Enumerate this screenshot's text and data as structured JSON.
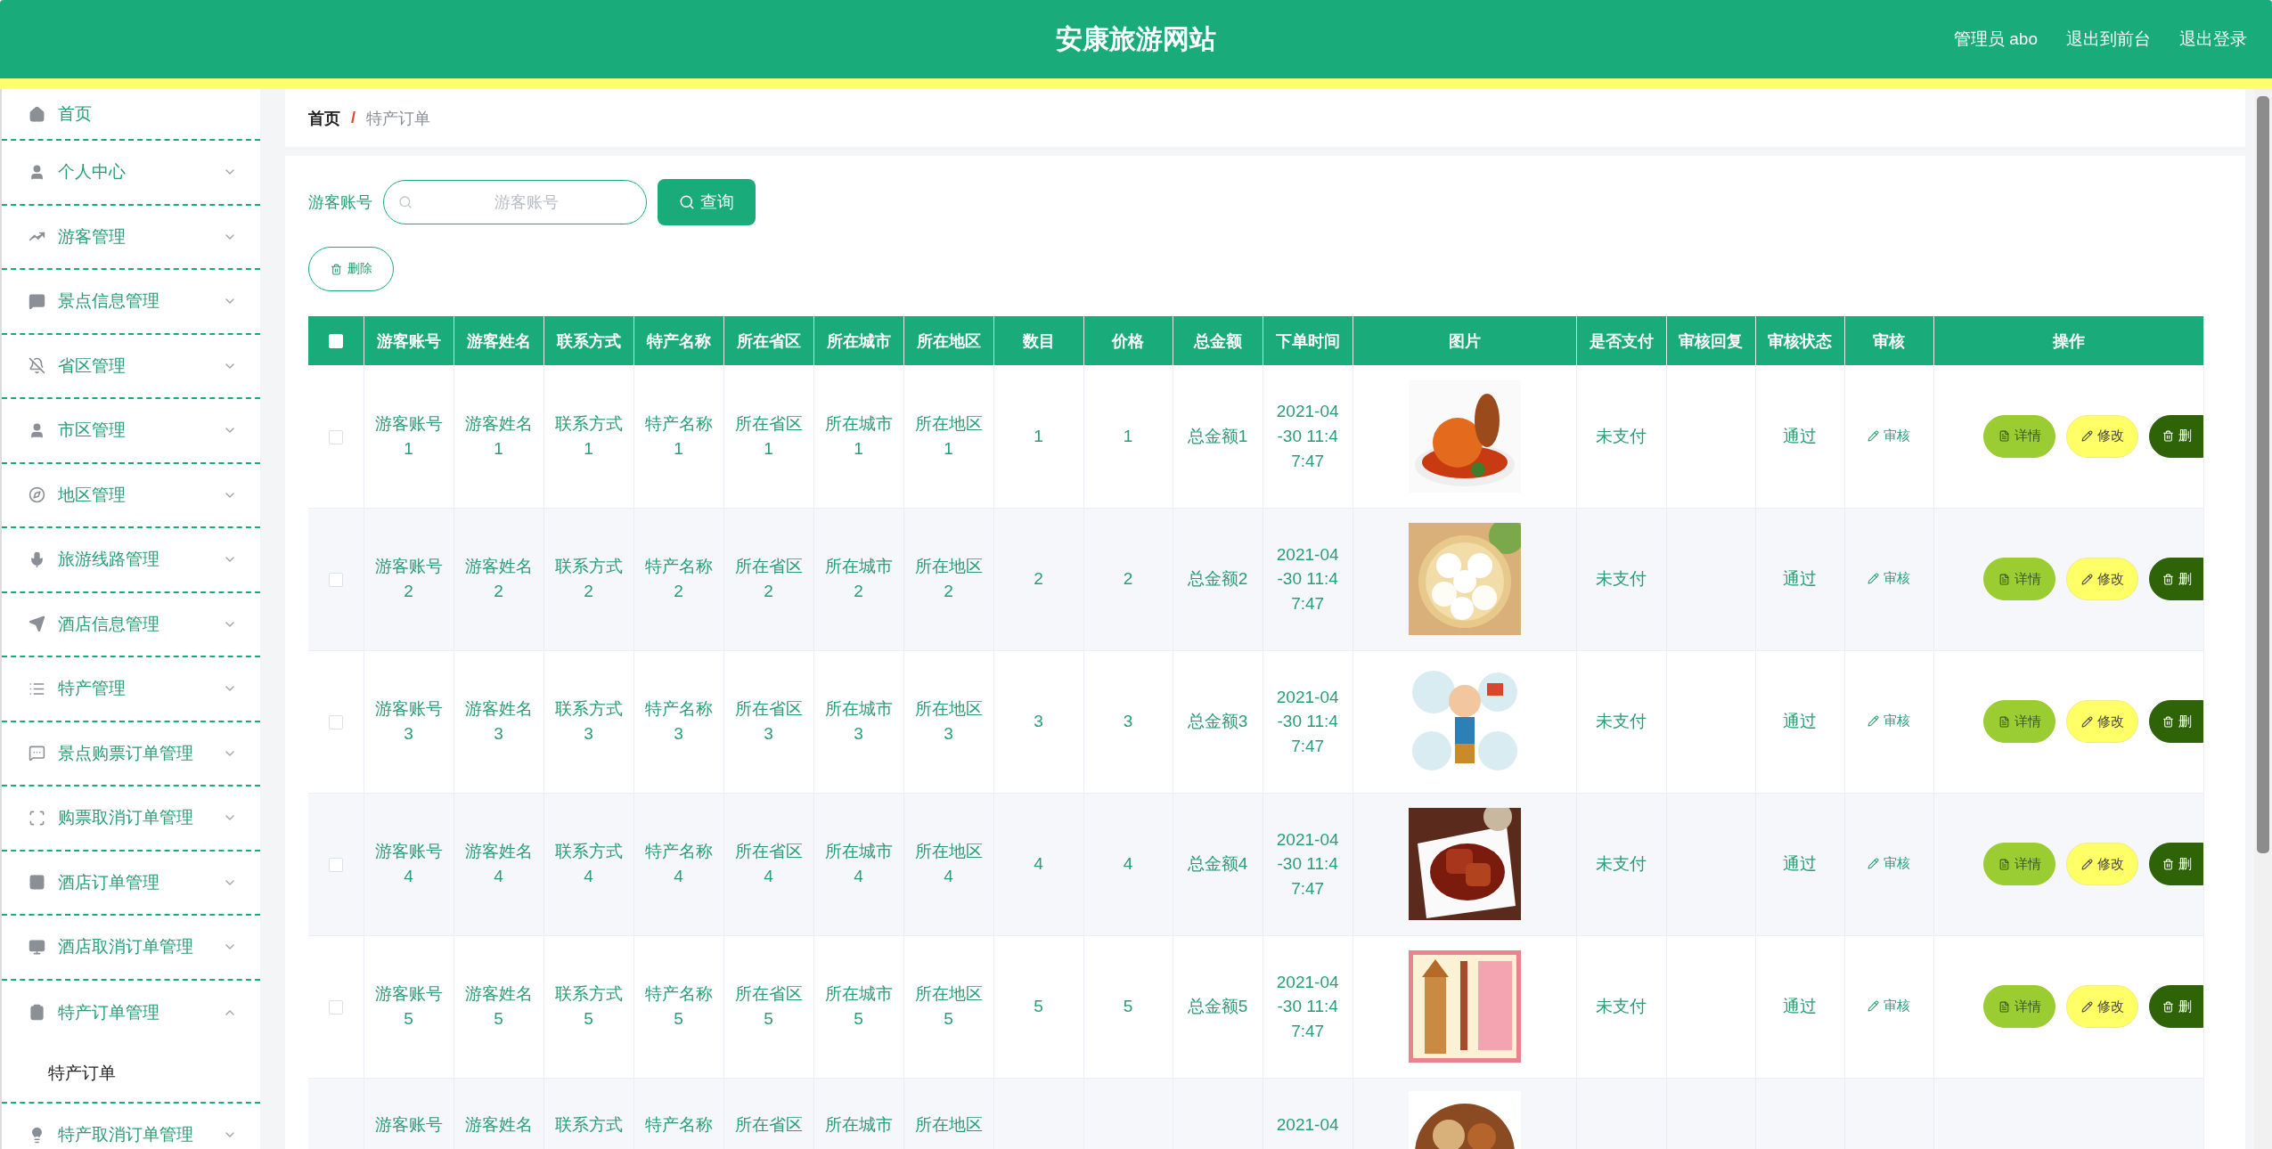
{
  "header": {
    "title": "安康旅游网站",
    "links": [
      "管理员 abo",
      "退出到前台",
      "退出登录"
    ]
  },
  "sidebar": {
    "items": [
      {
        "kind": "link",
        "label": "首页"
      },
      {
        "kind": "menu",
        "label": "个人中心",
        "expanded": false
      },
      {
        "kind": "menu",
        "label": "游客管理",
        "expanded": false
      },
      {
        "kind": "menu",
        "label": "景点信息管理",
        "expanded": false
      },
      {
        "kind": "menu",
        "label": "省区管理",
        "expanded": false
      },
      {
        "kind": "menu",
        "label": "市区管理",
        "expanded": false
      },
      {
        "kind": "menu",
        "label": "地区管理",
        "expanded": false
      },
      {
        "kind": "menu",
        "label": "旅游线路管理",
        "expanded": false
      },
      {
        "kind": "menu",
        "label": "酒店信息管理",
        "expanded": false
      },
      {
        "kind": "menu",
        "label": "特产管理",
        "expanded": false
      },
      {
        "kind": "menu",
        "label": "景点购票订单管理",
        "expanded": false
      },
      {
        "kind": "menu",
        "label": "购票取消订单管理",
        "expanded": false
      },
      {
        "kind": "menu",
        "label": "酒店订单管理",
        "expanded": false
      },
      {
        "kind": "menu",
        "label": "酒店取消订单管理",
        "expanded": false
      },
      {
        "kind": "menu",
        "label": "特产订单管理",
        "expanded": true,
        "children": [
          {
            "label": "特产订单",
            "selected": true
          }
        ]
      },
      {
        "kind": "menu",
        "label": "特产取消订单管理",
        "expanded": false
      }
    ]
  },
  "breadcrumb": {
    "items": [
      "首页",
      "特产订单"
    ],
    "separator": "/"
  },
  "search": {
    "label": "游客账号",
    "placeholder": "游客账号",
    "button": "查询"
  },
  "delete_button": "删除",
  "table": {
    "select_all": {
      "checked": false
    },
    "columns": [
      "游客账号",
      "游客姓名",
      "联系方式",
      "特产名称",
      "所在省区",
      "所在城市",
      "所在地区",
      "数目",
      "价格",
      "总金额",
      "下单时间",
      "图片",
      "是否支付",
      "审核回复",
      "审核状态",
      "审核",
      "操作"
    ],
    "rows": [
      {
        "kind": "full",
        "checked": false,
        "values": [
          "游客账号1",
          "游客姓名1",
          "联系方式1",
          "特产名称1",
          "所在省区1",
          "所在城市1",
          "所在地区1",
          "1",
          "1",
          "总金额1",
          "2021-04-30 11:47:47"
        ],
        "payment": "未支付",
        "status": "通过",
        "audit": "审核",
        "actions": [
          "详情",
          "修改",
          "删"
        ]
      },
      {
        "kind": "full",
        "checked": false,
        "values": [
          "游客账号2",
          "游客姓名2",
          "联系方式2",
          "特产名称2",
          "所在省区2",
          "所在城市2",
          "所在地区2",
          "2",
          "2",
          "总金额2",
          "2021-04-30 11:47:47"
        ],
        "payment": "未支付",
        "status": "通过",
        "audit": "审核",
        "actions": [
          "详情",
          "修改",
          "删"
        ]
      },
      {
        "kind": "full",
        "checked": false,
        "values": [
          "游客账号3",
          "游客姓名3",
          "联系方式3",
          "特产名称3",
          "所在省区3",
          "所在城市3",
          "所在地区3",
          "3",
          "3",
          "总金额3",
          "2021-04-30 11:47:47"
        ],
        "payment": "未支付",
        "status": "通过",
        "audit": "审核",
        "actions": [
          "详情",
          "修改",
          "删"
        ]
      },
      {
        "kind": "full",
        "checked": false,
        "values": [
          "游客账号4",
          "游客姓名4",
          "联系方式4",
          "特产名称4",
          "所在省区4",
          "所在城市4",
          "所在地区4",
          "4",
          "4",
          "总金额4",
          "2021-04-30 11:47:47"
        ],
        "payment": "未支付",
        "status": "通过",
        "audit": "审核",
        "actions": [
          "详情",
          "修改",
          "删"
        ]
      },
      {
        "kind": "full",
        "checked": false,
        "values": [
          "游客账号5",
          "游客姓名5",
          "联系方式5",
          "特产名称5",
          "所在省区5",
          "所在城市5",
          "所在地区5",
          "5",
          "5",
          "总金额5",
          "2021-04-30 11:47:47"
        ],
        "payment": "未支付",
        "status": "通过",
        "audit": "审核",
        "actions": [
          "详情",
          "修改",
          "删"
        ]
      },
      {
        "kind": "cut",
        "values": [
          "游客账号",
          "游客姓名",
          "联系方式",
          "特产名称",
          "所在省区",
          "所在城市",
          "所在地区"
        ],
        "time": "2021-04"
      }
    ]
  }
}
